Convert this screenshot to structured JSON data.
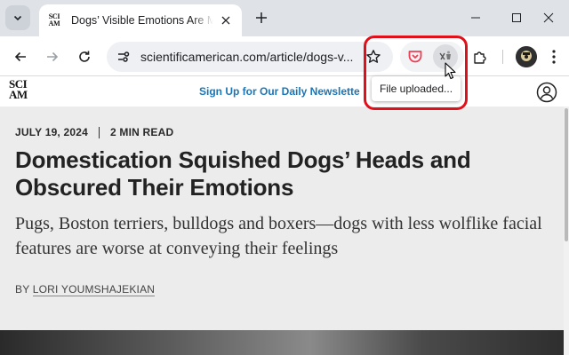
{
  "tab": {
    "favicon_lines": [
      "SCI",
      "AM"
    ],
    "title": "Dogs’ Visible Emotions Are Muc"
  },
  "omnibox": {
    "url": "scientificamerican.com/article/dogs-v..."
  },
  "tooltip": {
    "text": "File uploaded..."
  },
  "site": {
    "logo_lines": [
      "SCI",
      "AM"
    ],
    "signup": "Sign Up for Our Daily Newslette"
  },
  "article": {
    "date": "JULY 19, 2024",
    "read_time": "2 MIN READ",
    "headline": "Domestication Squished Dogs’ Heads and Obscured Their Emotions",
    "subhead": "Pugs, Boston terriers, bulldogs and boxers—dogs with less wolflike facial features are worse at conveying their feelings",
    "byline_prefix": "BY ",
    "author": "LORI YOUMSHAJEKIAN"
  },
  "colors": {
    "highlight": "#e0101a",
    "signup_link": "#1a76b7",
    "pocket": "#ef3f56"
  },
  "icons": [
    "tab-search-icon",
    "close-icon",
    "plus-icon",
    "minimize-icon",
    "maximize-icon",
    "close-window-icon",
    "back-arrow-icon",
    "forward-arrow-icon",
    "reload-icon",
    "site-info-icon",
    "star-icon",
    "pocket-icon",
    "extension-icon",
    "puzzle-icon",
    "avatar",
    "kebab-menu-icon",
    "account-icon",
    "cursor-icon"
  ]
}
